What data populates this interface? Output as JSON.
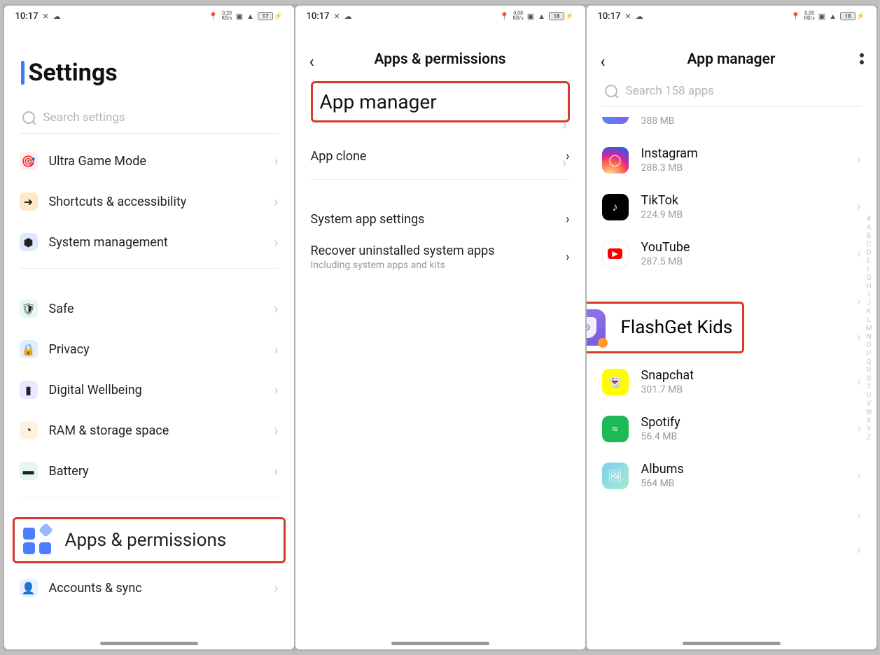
{
  "status": {
    "time": "10:17",
    "kbs1": "0.20",
    "kbs2": "0.00",
    "batt1": "17",
    "batt2": "18",
    "batt3": "18"
  },
  "screen1": {
    "title": "Settings",
    "search_placeholder": "Search settings",
    "items": [
      {
        "label": "Ultra Game Mode"
      },
      {
        "label": "Shortcuts & accessibility"
      },
      {
        "label": "System management"
      },
      {
        "label": "Safe"
      },
      {
        "label": "Privacy"
      },
      {
        "label": "Digital Wellbeing"
      },
      {
        "label": "RAM & storage space"
      },
      {
        "label": "Battery"
      }
    ],
    "highlight": "Apps & permissions",
    "after_highlight": "Accounts & sync"
  },
  "screen2": {
    "title": "Apps & permissions",
    "highlight": "App manager",
    "items": [
      {
        "label": "App clone"
      },
      {
        "label": "System app settings"
      },
      {
        "label": "Recover uninstalled system apps",
        "sub": "Including system apps and kits"
      }
    ]
  },
  "screen3": {
    "title": "App manager",
    "search_placeholder": "Search 158 apps",
    "top_partial_size": "388 MB",
    "apps": [
      {
        "name": "Instagram",
        "size": "288.3 MB"
      },
      {
        "name": "TikTok",
        "size": "224.9 MB"
      },
      {
        "name": "YouTube",
        "size": "287.5 MB"
      },
      {
        "name": "Snapchat",
        "size": "301.7 MB"
      },
      {
        "name": "Spotify",
        "size": "56.4 MB"
      },
      {
        "name": "Albums",
        "size": "564 MB"
      }
    ],
    "highlight": "FlashGet Kids"
  },
  "alpha": [
    "#",
    "A",
    "B",
    "C",
    "D",
    "E",
    "F",
    "G",
    "H",
    "I",
    "J",
    "K",
    "L",
    "M",
    "N",
    "O",
    "P",
    "Q",
    "R",
    "S",
    "T",
    "U",
    "V",
    "W",
    "X",
    "Y",
    "Z"
  ]
}
